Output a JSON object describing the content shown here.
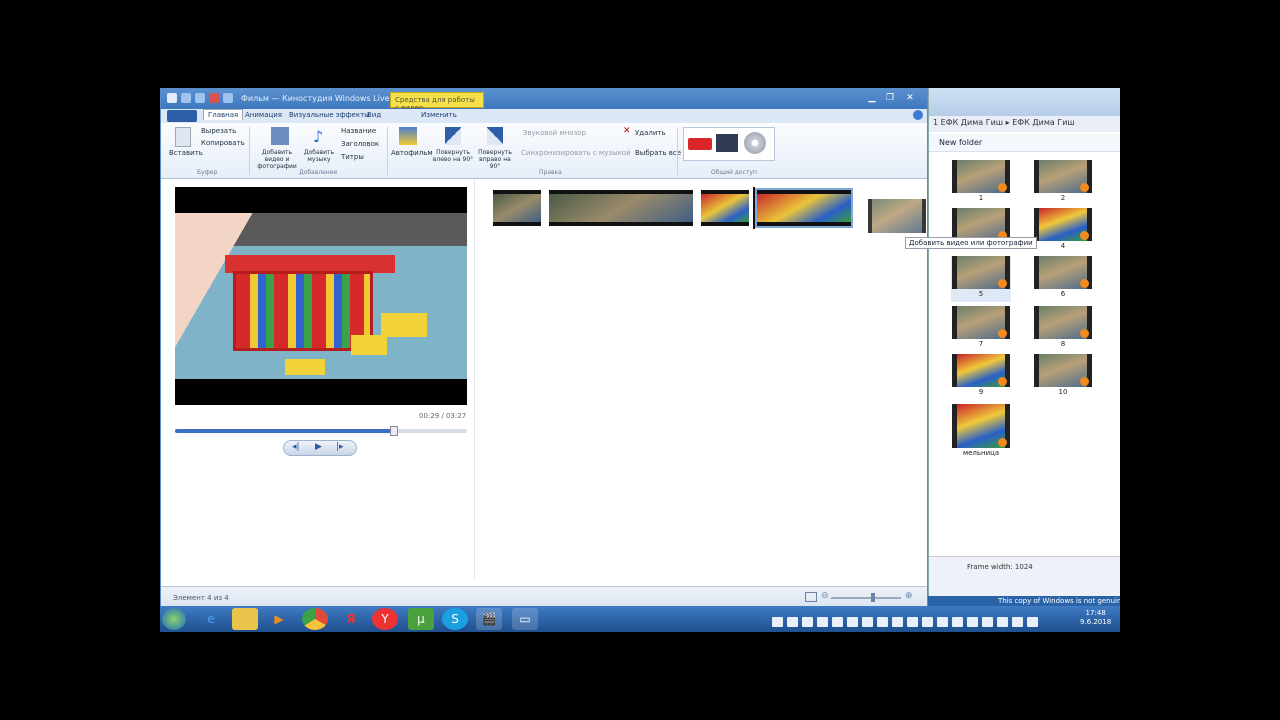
{
  "app": {
    "title": "Фильм — Киностудия Windows Live",
    "context_tab": "Средства для работы с видео"
  },
  "tabs": [
    "Главная",
    "Анимация",
    "Визуальные эффекты",
    "Вид",
    "Изменить"
  ],
  "ribbon": {
    "clipboard": {
      "paste": "Вставить",
      "cut": "Вырезать",
      "copy": "Копировать",
      "group": "Буфер"
    },
    "add": {
      "add_media": "Добавить видео и фотографии",
      "add_music": "Добавить музыку",
      "title": "Название",
      "caption": "Заголовок",
      "credits": "Титры",
      "group": "Добавление"
    },
    "edit": {
      "automovie": "Автофильм",
      "rotate_left": "Повернуть влево на 90°",
      "rotate_right": "Повернуть вправо на 90°",
      "narration": "Звуковой мнозор",
      "sync": "Синхронизировать с музыкой",
      "delete": "Удалить",
      "select_all": "Выбрать все",
      "group": "Правка"
    },
    "share": {
      "group": "Общий доступ"
    }
  },
  "player": {
    "time": "00:29 / 03:27",
    "progress": 0.75
  },
  "storyboard": {
    "drag_hint": "Добавить видео или фотографии"
  },
  "status": {
    "text": "Элемент 4 из 4"
  },
  "explorer": {
    "address": "1 ЕФК Дима Гиш ▸ ЕФК Дима Гиш",
    "toolbar": "New folder",
    "items": [
      "1",
      "2",
      "3",
      "4",
      "5",
      "6",
      "7",
      "8",
      "9",
      "10",
      "мельница"
    ],
    "footer": "Frame width: 1024"
  },
  "taskbar": {
    "clock_time": "17:48",
    "clock_date": "9.6.2018",
    "genuine": "This copy of Windows is not genuine"
  }
}
